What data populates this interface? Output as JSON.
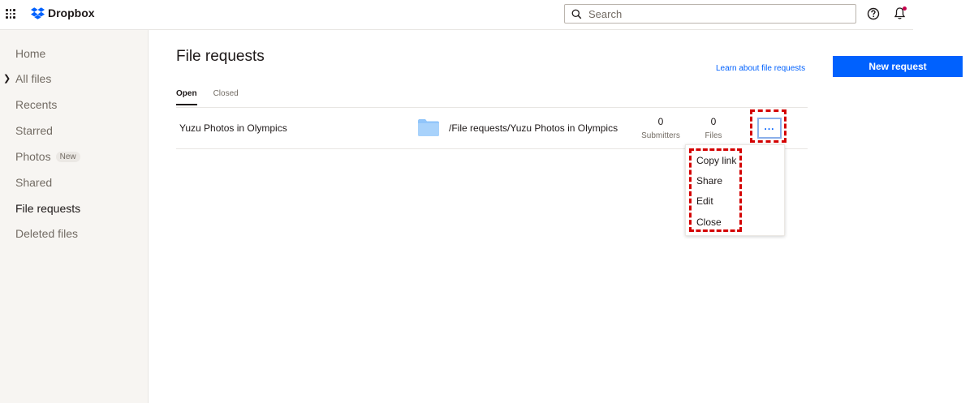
{
  "topbar": {
    "logo_text": "Dropbox",
    "search_placeholder": "Search"
  },
  "sidebar": {
    "items": [
      {
        "label": "Home"
      },
      {
        "label": "All files"
      },
      {
        "label": "Recents"
      },
      {
        "label": "Starred"
      },
      {
        "label": "Photos",
        "badge": "New"
      },
      {
        "label": "Shared"
      },
      {
        "label": "File requests"
      },
      {
        "label": "Deleted files"
      }
    ]
  },
  "main": {
    "title": "File requests",
    "learn_link": "Learn about file requests",
    "new_request_label": "New request",
    "tabs": [
      {
        "label": "Open"
      },
      {
        "label": "Closed"
      }
    ],
    "row": {
      "name": "Yuzu Photos in Olympics",
      "path": "/File requests/Yuzu Photos in Olympics",
      "submitters_count": "0",
      "submitters_label": "Submitters",
      "files_count": "0",
      "files_label": "Files",
      "more_label": "..."
    },
    "menu": {
      "items": [
        "Copy link",
        "Share",
        "Edit",
        "Close"
      ]
    }
  },
  "colors": {
    "accent": "#0061fe",
    "highlight": "#d40000",
    "sidebar_bg": "#f7f5f2",
    "folder": "#91c5fa"
  }
}
